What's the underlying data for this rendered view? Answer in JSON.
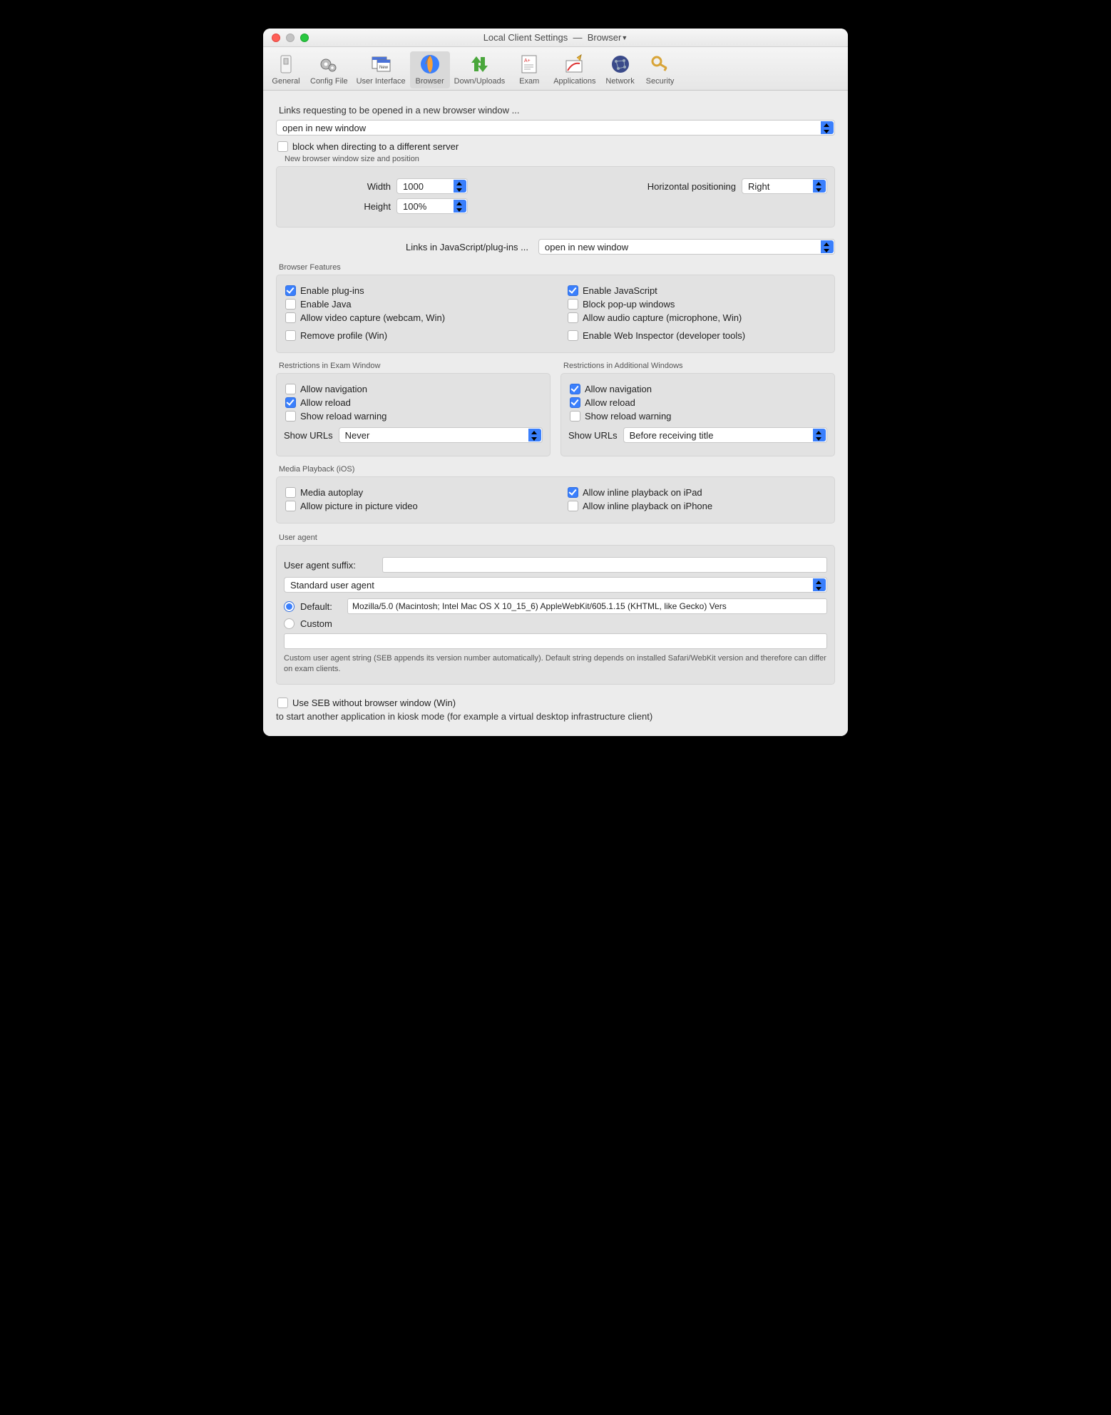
{
  "title": {
    "left": "Local Client Settings",
    "sep": "—",
    "right": "Browser"
  },
  "toolbar": {
    "general": "General",
    "config": "Config File",
    "ui": "User Interface",
    "browser": "Browser",
    "downup": "Down/Uploads",
    "exam": "Exam",
    "apps": "Applications",
    "network": "Network",
    "security": "Security"
  },
  "links_heading": "Links requesting to be opened in a new browser window ...",
  "links_open_mode": "open in new window",
  "block_diff_server": "block when directing to a different server",
  "newwin": {
    "group": "New browser window size and position",
    "width_label": "Width",
    "width_val": "1000",
    "height_label": "Height",
    "height_val": "100%",
    "hpos_label": "Horizontal positioning",
    "hpos_val": "Right"
  },
  "links_js_label": "Links in JavaScript/plug-ins ...",
  "links_js_val": "open in new window",
  "features": {
    "group": "Browser Features",
    "plugins": "Enable plug-ins",
    "java": "Enable Java",
    "video": "Allow video capture (webcam, Win)",
    "remove_profile": "Remove profile (Win)",
    "js": "Enable JavaScript",
    "popup": "Block pop-up windows",
    "audio": "Allow audio capture (microphone, Win)",
    "inspector": "Enable Web Inspector (developer tools)"
  },
  "restrict_exam": {
    "group": "Restrictions in Exam Window",
    "nav": "Allow navigation",
    "reload": "Allow reload",
    "warn": "Show reload warning",
    "showurls_label": "Show URLs",
    "showurls_val": "Never"
  },
  "restrict_add": {
    "group": "Restrictions in Additional Windows",
    "nav": "Allow navigation",
    "reload": "Allow reload",
    "warn": "Show reload warning",
    "showurls_label": "Show URLs",
    "showurls_val": "Before receiving title"
  },
  "media": {
    "group": "Media Playback (iOS)",
    "autoplay": "Media autoplay",
    "pip": "Allow picture in picture video",
    "inline_ipad": "Allow inline playback on iPad",
    "inline_iphone": "Allow inline playback on iPhone"
  },
  "ua": {
    "group": "User agent",
    "suffix_label": "User agent suffix:",
    "mode": "Standard user agent",
    "default": "Default:",
    "default_val": "Mozilla/5.0 (Macintosh; Intel Mac OS X 10_15_6) AppleWebKit/605.1.15 (KHTML, like Gecko) Vers",
    "custom": "Custom",
    "help": "Custom user agent string (SEB appends its version number automatically). Default string depends on installed Safari/WebKit version and therefore can differ on exam clients."
  },
  "kiosk": {
    "cb": "Use SEB without browser window (Win)",
    "help": "to start another application in kiosk mode (for example a virtual desktop infrastructure client)"
  }
}
